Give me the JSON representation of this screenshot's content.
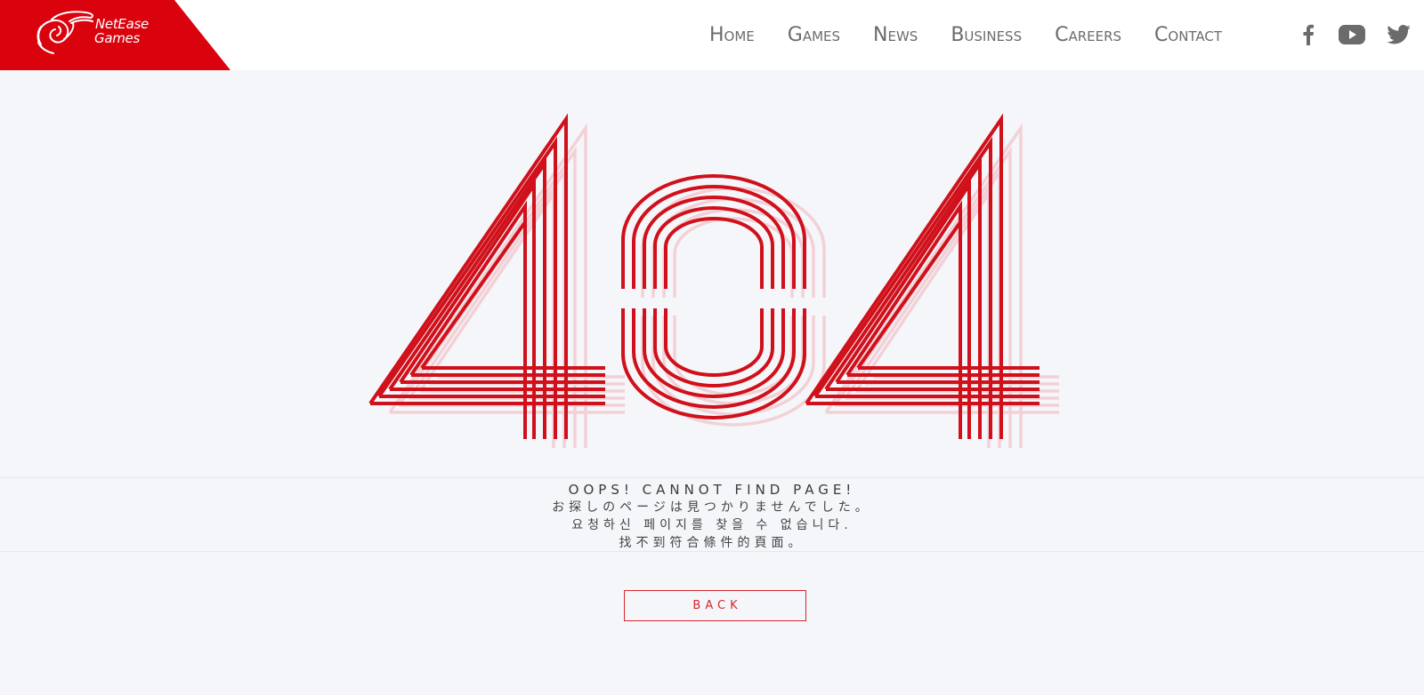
{
  "brand": {
    "line1": "NetEase",
    "line2": "Games",
    "logo_color": "#d9020d",
    "emblem_icon": "netease-swirl-icon"
  },
  "nav": {
    "items": [
      {
        "label": "Home"
      },
      {
        "label": "Games"
      },
      {
        "label": "News"
      },
      {
        "label": "Business"
      },
      {
        "label": "Careers"
      },
      {
        "label": "Contact"
      }
    ]
  },
  "social": {
    "icons": [
      "facebook-icon",
      "youtube-icon",
      "twitter-icon"
    ],
    "color": "#6b6b6b"
  },
  "error": {
    "code": "404",
    "stroke_color": "#d0101a",
    "shadow_color": "#f2cdd3",
    "line_en": "OOPS! CANNOT FIND PAGE!",
    "line_ja": "お探しのページは見つかりませんでした。",
    "line_ko": "요청하신 페이지를 찾을 수 없습니다.",
    "line_zh": "找不到符合條件的頁面。"
  },
  "actions": {
    "back_label": "BACK",
    "accent": "#d7262f"
  }
}
